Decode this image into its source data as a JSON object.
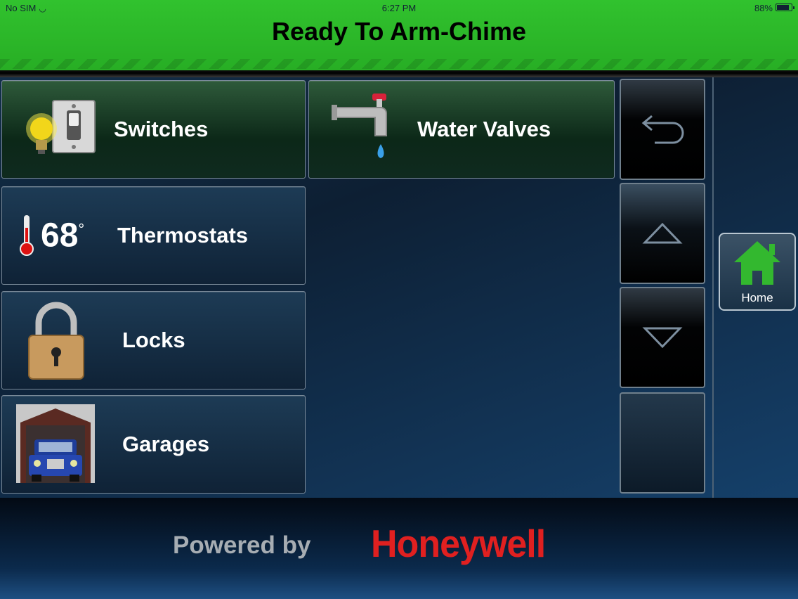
{
  "status_bar": {
    "carrier": "No SIM",
    "time": "6:27 PM",
    "battery": "88%"
  },
  "header": {
    "title": "Ready To Arm-Chime",
    "color": "#2db92a"
  },
  "tiles": [
    {
      "label": "Switches",
      "icon": "light-switch-icon"
    },
    {
      "label": "Thermostats",
      "icon": "thermometer-icon",
      "temperature": "68"
    },
    {
      "label": "Locks",
      "icon": "padlock-icon"
    },
    {
      "label": "Garages",
      "icon": "garage-car-icon"
    },
    {
      "label": "Water Valves",
      "icon": "faucet-icon"
    }
  ],
  "side_controls": {
    "back": "back-arrow-icon",
    "up": "up-triangle-icon",
    "down": "down-triangle-icon"
  },
  "home": {
    "label": "Home",
    "icon": "house-icon",
    "icon_color": "#33b82f"
  },
  "footer": {
    "powered_by": "Powered by",
    "brand": "Honeywell",
    "brand_color": "#e02020"
  }
}
